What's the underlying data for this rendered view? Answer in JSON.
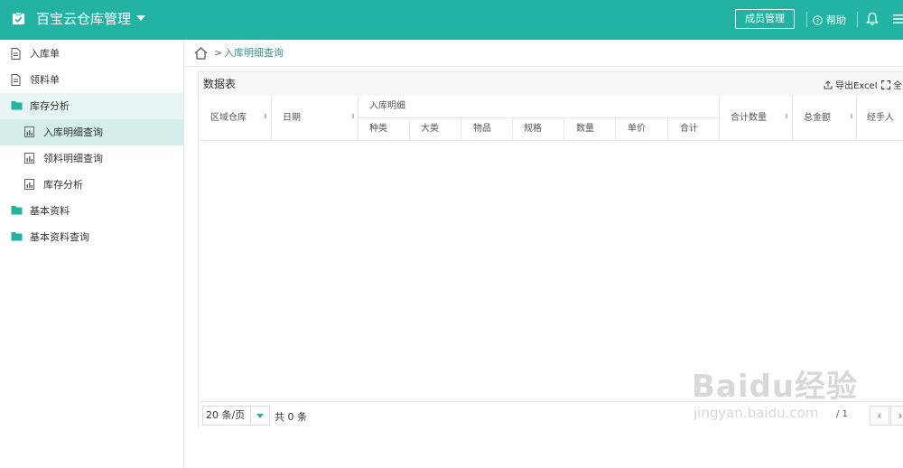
{
  "header": {
    "app_title": "百宝云仓库管理",
    "member_button": "成员管理",
    "help_label": "帮助"
  },
  "sidebar": {
    "items": [
      {
        "label": "入库单",
        "icon": "document-icon"
      },
      {
        "label": "领料单",
        "icon": "document-icon"
      },
      {
        "label": "库存分析",
        "icon": "folder-icon"
      },
      {
        "label": "入库明细查询",
        "icon": "report-icon"
      },
      {
        "label": "领料明细查询",
        "icon": "report-icon"
      },
      {
        "label": "库存分析",
        "icon": "report-icon"
      },
      {
        "label": "基本资料",
        "icon": "folder-icon"
      },
      {
        "label": "基本资料查询",
        "icon": "folder-icon"
      }
    ]
  },
  "breadcrumb": {
    "current": "入库明细查询"
  },
  "panel": {
    "title": "数据表",
    "export_label": "导出Excel",
    "fullscreen_label": "全"
  },
  "table": {
    "columns": {
      "warehouse": "区域仓库",
      "date": "日期",
      "group": "入库明细",
      "kind": "种类",
      "category": "大类",
      "item": "物品",
      "spec": "规格",
      "quantity": "数量",
      "unit_price": "单价",
      "subtotal": "合计",
      "total_quantity": "合计数量",
      "total_amount": "总金额",
      "handler": "经手人"
    }
  },
  "pager": {
    "page_size": "20 条/页",
    "total": "共 0 条",
    "page_info": "/ 1"
  },
  "watermark": {
    "line1": "Baidu经验",
    "line2": "jingyan.baidu.com"
  },
  "colors": {
    "brand": "#23b3a3",
    "sidebar_active": "#d4efec"
  }
}
